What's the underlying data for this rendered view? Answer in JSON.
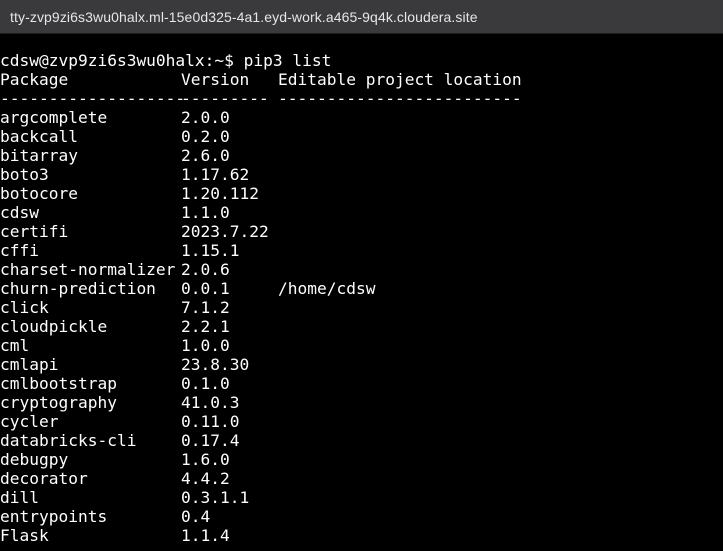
{
  "titlebar": {
    "url": "tty-zvp9zi6s3wu0halx.ml-15e0d325-4a1.eyd-work.a465-9q4k.cloudera.site"
  },
  "terminal": {
    "prompt": "cdsw@zvp9zi6s3wu0halx:~$ pip3 list",
    "header": {
      "package": "Package",
      "version": "Version",
      "location": "Editable project location"
    },
    "separator": {
      "package": "-------------------",
      "version": "---------",
      "location": "-------------------------"
    },
    "packages": [
      {
        "name": "argcomplete",
        "version": "2.0.0",
        "location": ""
      },
      {
        "name": "backcall",
        "version": "0.2.0",
        "location": ""
      },
      {
        "name": "bitarray",
        "version": "2.6.0",
        "location": ""
      },
      {
        "name": "boto3",
        "version": "1.17.62",
        "location": ""
      },
      {
        "name": "botocore",
        "version": "1.20.112",
        "location": ""
      },
      {
        "name": "cdsw",
        "version": "1.1.0",
        "location": ""
      },
      {
        "name": "certifi",
        "version": "2023.7.22",
        "location": ""
      },
      {
        "name": "cffi",
        "version": "1.15.1",
        "location": ""
      },
      {
        "name": "charset-normalizer",
        "version": "2.0.6",
        "location": ""
      },
      {
        "name": "churn-prediction",
        "version": "0.0.1",
        "location": "/home/cdsw"
      },
      {
        "name": "click",
        "version": "7.1.2",
        "location": ""
      },
      {
        "name": "cloudpickle",
        "version": "2.2.1",
        "location": ""
      },
      {
        "name": "cml",
        "version": "1.0.0",
        "location": ""
      },
      {
        "name": "cmlapi",
        "version": "23.8.30",
        "location": ""
      },
      {
        "name": "cmlbootstrap",
        "version": "0.1.0",
        "location": ""
      },
      {
        "name": "cryptography",
        "version": "41.0.3",
        "location": ""
      },
      {
        "name": "cycler",
        "version": "0.11.0",
        "location": ""
      },
      {
        "name": "databricks-cli",
        "version": "0.17.4",
        "location": ""
      },
      {
        "name": "debugpy",
        "version": "1.6.0",
        "location": ""
      },
      {
        "name": "decorator",
        "version": "4.4.2",
        "location": ""
      },
      {
        "name": "dill",
        "version": "0.3.1.1",
        "location": ""
      },
      {
        "name": "entrypoints",
        "version": "0.4",
        "location": ""
      },
      {
        "name": "Flask",
        "version": "1.1.4",
        "location": ""
      }
    ]
  }
}
